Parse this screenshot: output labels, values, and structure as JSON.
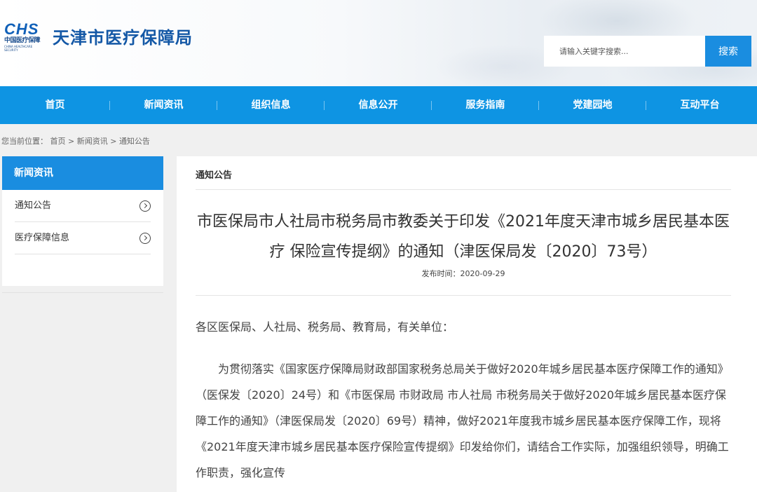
{
  "header": {
    "logo_text": "CHS",
    "logo_cn": "中国医疗保障",
    "logo_en": "CHINA HEALTHCARE SECURITY",
    "site_title": "天津市医疗保障局",
    "search_placeholder": "请输入关键字搜索...",
    "search_button": "搜索"
  },
  "nav": {
    "items": [
      "首页",
      "新闻资讯",
      "组织信息",
      "信息公开",
      "服务指南",
      "党建园地",
      "互动平台"
    ]
  },
  "breadcrumb": {
    "prefix": "您当前位置：",
    "home": "首页",
    "sep1": " > ",
    "section": "新闻资讯",
    "sep2": " > ",
    "current": "通知公告"
  },
  "sidebar": {
    "heading": "新闻资讯",
    "items": [
      {
        "label": "通知公告",
        "icon": "circle-chevron-right-icon"
      },
      {
        "label": "医疗保障信息",
        "icon": "circle-chevron-right-icon"
      }
    ]
  },
  "main": {
    "section_heading": "通知公告",
    "title": "市医保局市人社局市税务局市教委关于印发《2021年度天津市城乡居民基本医疗 保险宣传提纲》的通知（津医保局发〔2020〕73号）",
    "published_at": "发布时间：2020-09-29",
    "salutation": "各区医保局、人社局、税务局、教育局，有关单位：",
    "paragraph": "为贯彻落实《国家医疗保障局财政部国家税务总局关于做好2020年城乡居民基本医疗保障工作的通知》（医保发〔2020〕24号）和《市医保局 市财政局 市人社局 市税务局关于做好2020年城乡居民基本医疗保障工作的通知》（津医保局发〔2020〕69号）精神，做好2021年度我市城乡居民基本医疗保障工作，现将《2021年度天津市城乡居民基本医疗保险宣传提纲》印发给你们，请结合工作实际，加强组织领导，明确工作职责，强化宣传"
  },
  "colors": {
    "nav_bg": "#0e94e3",
    "accent": "#1a8de0",
    "title_blue": "#1458a6",
    "page_bg": "#f0f0f0"
  }
}
